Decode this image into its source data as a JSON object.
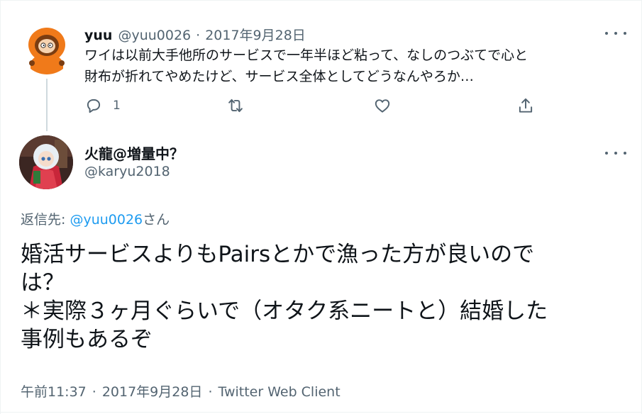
{
  "parent_tweet": {
    "display_name": "yuu",
    "handle": "@yuu0026",
    "separator": "·",
    "date": "2017年9月28日",
    "text_line1": "ワイは以前大手他所のサービスで一年半ほど粘って、なしのつぶてで心と",
    "text_line2": "財布が折れてやめたけど、サービス全体としてどうなんやろか…",
    "reply_count": "1",
    "avatar_icon": "kenny-orange-parka-avatar"
  },
  "reply_tweet": {
    "display_name": "火龍@増量中？",
    "handle": "@karyu2018",
    "replying_to_label": "返信先: ",
    "replying_to_mention": "@yuu0026",
    "replying_to_suffix": "さん",
    "text_line1": "婚活サービスよりもPairsとかで漁った方が良いので",
    "text_line2": "は？",
    "text_line3": "＊実際３ヶ月ぐらいで（オタク系ニートと）結婚した",
    "text_line4": "事例もあるぞ",
    "time": "午前11:37",
    "separator": "·",
    "date": "2017年9月28日",
    "source": "Twitter Web Client",
    "avatar_icon": "doll-photo-avatar"
  },
  "icons": {
    "reply": "reply-icon",
    "retweet": "retweet-icon",
    "like": "like-icon",
    "share": "share-icon",
    "more": "more-icon"
  },
  "colors": {
    "text": "#0f1419",
    "muted": "#536471",
    "link": "#1d9bf0",
    "divider": "#cfd9de"
  }
}
